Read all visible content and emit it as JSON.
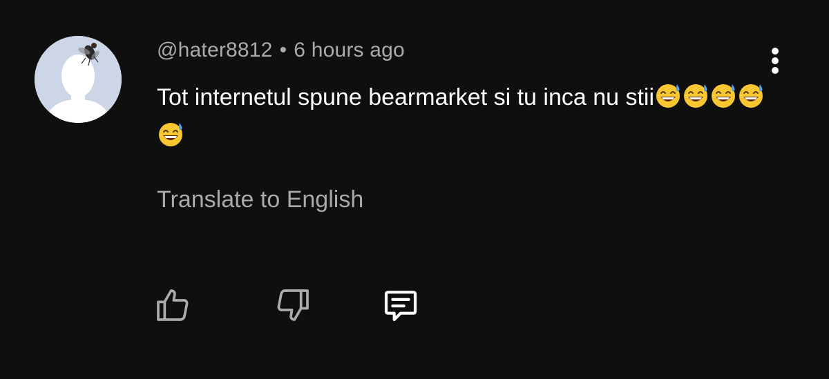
{
  "comment": {
    "author": "@hater8812",
    "separator": "•",
    "time": "6 hours ago",
    "text": "Tot internetul spune bearmarket si tu inca nu stii",
    "emoji": "😅",
    "emoji_count": 5,
    "translate_label": "Translate to English"
  },
  "icons": {
    "more": "more-vert-icon",
    "like": "thumb-up-icon",
    "dislike": "thumb-down-icon",
    "reply": "comment-icon"
  },
  "colors": {
    "background": "#0f0f0f",
    "text": "#ffffff",
    "secondary_text": "#aaaaaa",
    "icon": "#aaaaaa",
    "reply_icon": "#ffffff"
  }
}
